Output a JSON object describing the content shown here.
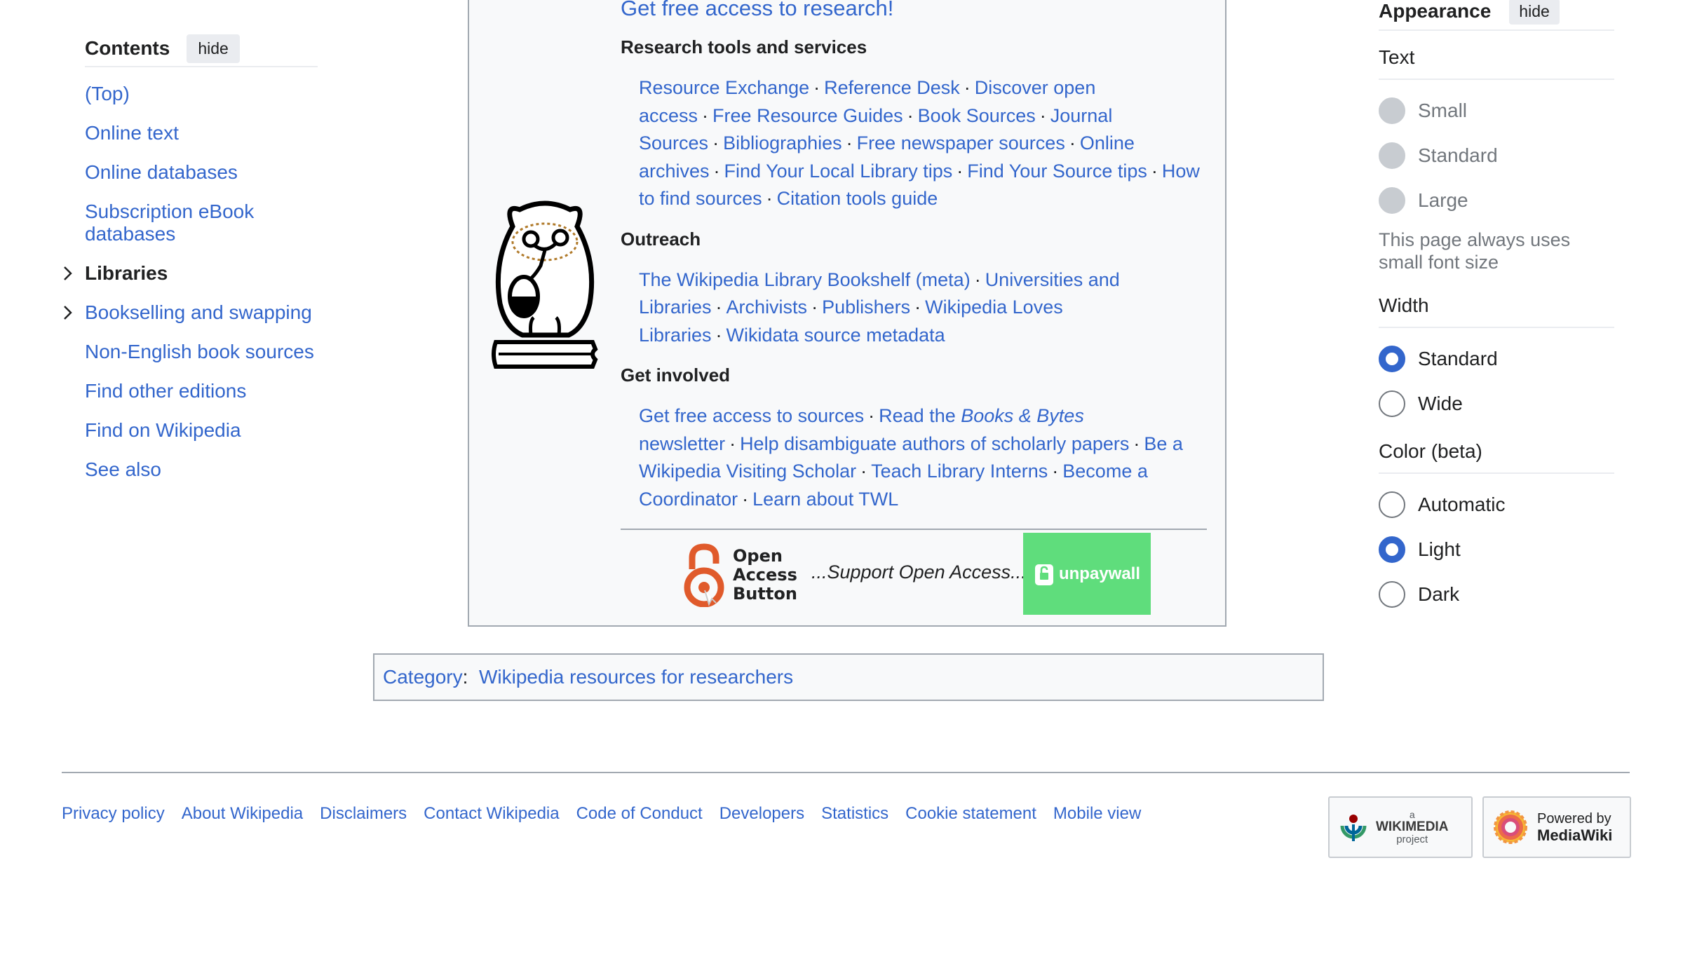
{
  "toc": {
    "title": "Contents",
    "hide_label": "hide",
    "items": [
      {
        "label": "(Top)",
        "expandable": false
      },
      {
        "label": "Online text",
        "expandable": false
      },
      {
        "label": "Online databases",
        "expandable": false
      },
      {
        "label": "Subscription eBook databases",
        "expandable": false
      },
      {
        "label": "Libraries",
        "expandable": true
      },
      {
        "label": "Bookselling and swapping",
        "expandable": true
      },
      {
        "label": "Non-English book sources",
        "expandable": false
      },
      {
        "label": "Find other editions",
        "expandable": false
      },
      {
        "label": "Find on Wikipedia",
        "expandable": false
      },
      {
        "label": "See also",
        "expandable": false
      }
    ]
  },
  "resources": {
    "headline": "Get free access to research!",
    "sections": [
      {
        "title": "Research tools and services",
        "links": [
          "Resource Exchange",
          "Reference Desk",
          "Discover open access",
          "Free Resource Guides",
          "Book Sources",
          "Journal Sources",
          "Bibliographies",
          "Free newspaper sources",
          "Online archives",
          "Find Your Local Library tips",
          "Find Your Source tips",
          "How to find sources",
          "Citation tools guide"
        ]
      },
      {
        "title": "Outreach",
        "links": [
          "The Wikipedia Library Bookshelf (meta)",
          "Universities and Libraries",
          "Archivists",
          "Publishers",
          "Wikipedia Loves Libraries",
          "Wikidata source metadata"
        ]
      },
      {
        "title": "Get involved",
        "links": [
          "Get free access to sources",
          "Read the Books & Bytes newsletter",
          "Help disambiguate authors of scholarly papers",
          "Be a Wikipedia Visiting Scholar",
          "Teach Library Interns",
          "Become a Coordinator",
          "Learn about TWL"
        ]
      }
    ],
    "newsletter": {
      "prefix": "Read the ",
      "italic": "Books & Bytes",
      "suffix": " newsletter"
    },
    "open_access_button": {
      "line1": "Open",
      "line2": "Access",
      "line3": "Button"
    },
    "support_text": "...Support Open Access...",
    "unpaywall_label": "unpaywall"
  },
  "category": {
    "label": "Category",
    "separator": ":",
    "value": "Wikipedia resources for researchers"
  },
  "appearance": {
    "title": "Appearance",
    "hide_label": "hide",
    "text_group": {
      "title": "Text",
      "options": [
        "Small",
        "Standard",
        "Large"
      ],
      "note": "This page always uses small font size"
    },
    "width_group": {
      "title": "Width",
      "options": [
        "Standard",
        "Wide"
      ],
      "selected": "Standard"
    },
    "color_group": {
      "title": "Color (beta)",
      "options": [
        "Automatic",
        "Light",
        "Dark"
      ],
      "selected": "Light"
    }
  },
  "footer": {
    "links": [
      "Privacy policy",
      "About Wikipedia",
      "Disclaimers",
      "Contact Wikipedia",
      "Code of Conduct",
      "Developers",
      "Statistics",
      "Cookie statement",
      "Mobile view"
    ],
    "wikimedia_badge": {
      "small": "a",
      "name": "WIKIMEDIA",
      "sub": "project"
    },
    "mediawiki_badge": {
      "line1": "Powered by",
      "line2": "MediaWiki"
    }
  },
  "colors": {
    "link": "#3366cc",
    "accent": "#3366cc",
    "unpaywall_green": "#5fdd7c",
    "oab_orange": "#e05a2b"
  }
}
